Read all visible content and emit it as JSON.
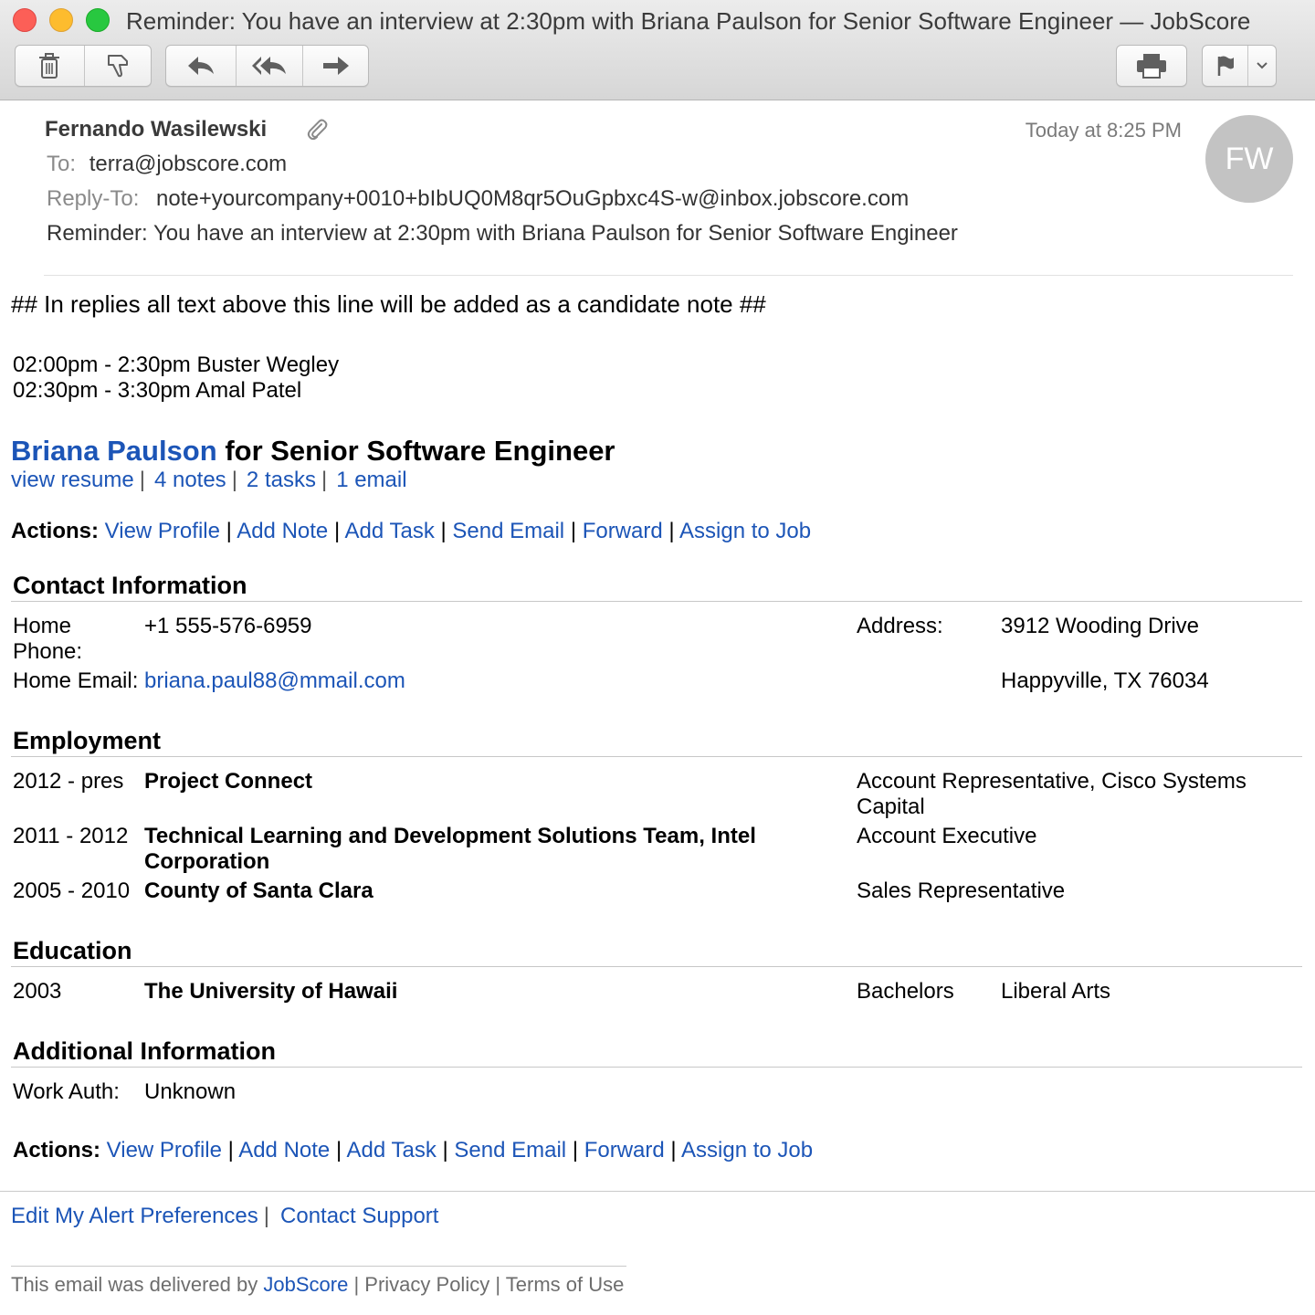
{
  "window": {
    "title": "Reminder: You have an interview at 2:30pm with Briana Paulson for Senior Software Engineer — JobScore"
  },
  "toolbar": {
    "icons": [
      "trash-icon",
      "junk-icon",
      "reply-icon",
      "reply-all-icon",
      "forward-icon",
      "print-icon",
      "flag-icon",
      "chevron-down-icon"
    ]
  },
  "header": {
    "sender": "Fernando Wasilewski",
    "date": "Today at 8:25 PM",
    "avatar_initials": "FW",
    "to_label": "To:",
    "to_value": "terra@jobscore.com",
    "replyto_label": "Reply-To:",
    "replyto_value": "note+yourcompany+0010+bIbUQ0M8qr5OuGpbxc4S-w@inbox.jobscore.com",
    "subject": "Reminder: You have an interview at 2:30pm with Briana Paulson for Senior Software Engineer"
  },
  "body": {
    "note_line": "## In replies all text above this line will be added as a candidate note ##",
    "schedule": [
      "02:00pm - 2:30pm Buster Wegley",
      "02:30pm - 3:30pm Amal Patel"
    ],
    "candidate": {
      "name": "Briana Paulson",
      "role_text": "for Senior Software Engineer"
    },
    "quick_links": [
      "view resume",
      "4 notes",
      "2 tasks",
      "1 email"
    ],
    "actions_label": "Actions:",
    "actions": [
      "View Profile",
      "Add Note",
      "Add Task",
      "Send Email",
      "Forward",
      "Assign to Job"
    ],
    "contact": {
      "heading": "Contact Information",
      "home_phone_label_1": "Home",
      "home_phone_label_2": "Phone:",
      "home_phone": "+1 555-576-6959",
      "home_email_label": "Home Email:",
      "home_email": "briana.paul88@mmail.com",
      "address_label": "Address:",
      "address_line1": "3912 Wooding Drive",
      "address_line2": "Happyville, TX 76034"
    },
    "employment": {
      "heading": "Employment",
      "rows": [
        {
          "years": "2012 - pres",
          "org_1": "Project Connect",
          "org_2": "",
          "title_1": "Account Representative, Cisco Systems",
          "title_2": "Capital"
        },
        {
          "years": "2011 - 2012",
          "org_1": "Technical Learning and Development Solutions Team, Intel",
          "org_2": "Corporation",
          "title_1": "Account Executive",
          "title_2": ""
        },
        {
          "years": "2005 - 2010",
          "org_1": "County of Santa Clara",
          "org_2": "",
          "title_1": "Sales Representative",
          "title_2": ""
        }
      ]
    },
    "education": {
      "heading": "Education",
      "year": "2003",
      "school": "The University of Hawaii",
      "degree": "Bachelors",
      "field": "Liberal Arts"
    },
    "additional": {
      "heading": "Additional Information",
      "work_auth_label": "Work Auth:",
      "work_auth_value": "Unknown"
    }
  },
  "footer": {
    "links": [
      "Edit My Alert Preferences",
      "Contact Support"
    ],
    "delivered_prefix": "This email was delivered by",
    "delivered_brand": "JobScore",
    "privacy": "Privacy Policy",
    "terms": "Terms of Use",
    "separator": "|"
  },
  "colors": {
    "link": "#1c55b7",
    "avatar": "#c3c3c3"
  }
}
